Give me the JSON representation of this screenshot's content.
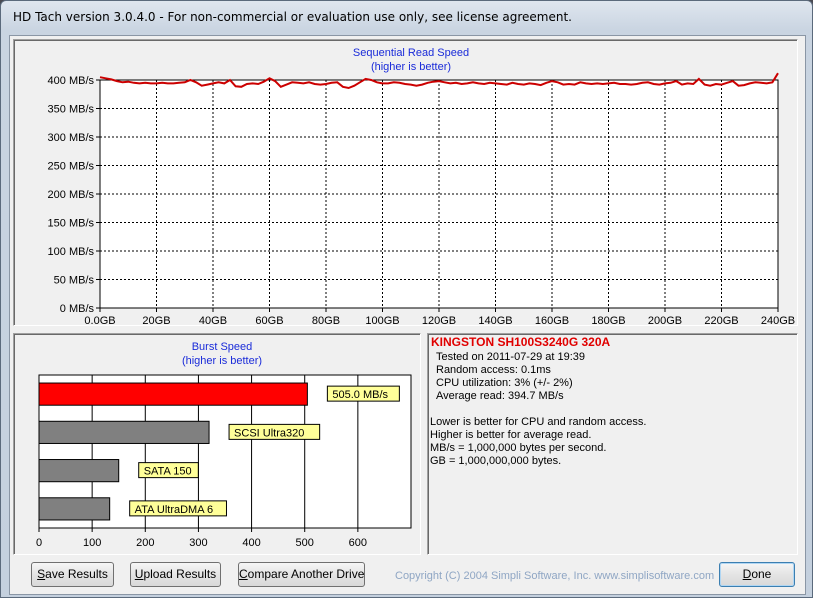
{
  "window": {
    "title": "HD Tach version 3.0.4.0  - For non-commercial or evaluation use only, see license agreement."
  },
  "sequential_chart": {
    "title_line1": "Sequential Read Speed",
    "title_line2": "(higher is better)"
  },
  "burst_chart": {
    "title_line1": "Burst Speed",
    "title_line2": "(higher is better)"
  },
  "chart_data": [
    {
      "type": "line",
      "title": "Sequential Read Speed",
      "subtitle": "(higher is better)",
      "xlabel": "",
      "ylabel": "",
      "x_tick_labels": [
        "0.0GB",
        "20GB",
        "40GB",
        "60GB",
        "80GB",
        "100GB",
        "120GB",
        "140GB",
        "160GB",
        "180GB",
        "200GB",
        "220GB",
        "240GB"
      ],
      "y_tick_labels": [
        "0 MB/s",
        "50 MB/s",
        "100 MB/s",
        "150 MB/s",
        "200 MB/s",
        "250 MB/s",
        "300 MB/s",
        "350 MB/s",
        "400 MB/s"
      ],
      "xlim": [
        0,
        240
      ],
      "ylim": [
        0,
        400
      ],
      "grid": true,
      "series_color": "#cc0000",
      "series": [
        {
          "x": [
            0,
            2,
            4,
            6,
            8,
            10,
            12,
            14,
            16,
            18,
            20,
            22,
            24,
            26,
            28,
            30,
            32,
            34,
            36,
            38,
            40,
            42,
            44,
            46,
            48,
            50,
            52,
            54,
            56,
            58,
            60,
            62,
            64,
            66,
            68,
            70,
            72,
            74,
            76,
            78,
            80,
            82,
            84,
            86,
            88,
            90,
            92,
            94,
            96,
            98,
            100,
            102,
            104,
            106,
            108,
            110,
            112,
            114,
            116,
            118,
            120,
            122,
            124,
            126,
            128,
            130,
            132,
            134,
            136,
            138,
            140,
            142,
            144,
            146,
            148,
            150,
            152,
            154,
            156,
            158,
            160,
            162,
            164,
            166,
            168,
            170,
            172,
            174,
            176,
            178,
            180,
            182,
            184,
            186,
            188,
            190,
            192,
            194,
            196,
            198,
            200,
            202,
            204,
            206,
            208,
            210,
            212,
            214,
            216,
            218,
            220,
            222,
            224,
            226,
            228,
            230,
            232,
            234,
            236,
            238,
            240
          ],
          "values": [
            405,
            403,
            401,
            398,
            396,
            397,
            395,
            394,
            395,
            394,
            394,
            395,
            394,
            394,
            395,
            396,
            400,
            396,
            390,
            392,
            394,
            396,
            394,
            400,
            389,
            388,
            393,
            394,
            393,
            397,
            403,
            398,
            388,
            392,
            396,
            395,
            394,
            396,
            393,
            392,
            393,
            395,
            396,
            388,
            386,
            390,
            396,
            402,
            400,
            396,
            394,
            394,
            396,
            395,
            393,
            392,
            390,
            392,
            395,
            397,
            398,
            396,
            394,
            395,
            393,
            394,
            396,
            394,
            393,
            395,
            394,
            393,
            392,
            395,
            393,
            392,
            394,
            393,
            391,
            395,
            398,
            396,
            392,
            393,
            392,
            396,
            394,
            393,
            394,
            393,
            394,
            395,
            393,
            393,
            392,
            393,
            395,
            396,
            393,
            392,
            394,
            395,
            398,
            392,
            394,
            393,
            402,
            392,
            390,
            393,
            392,
            395,
            398,
            390,
            391,
            394,
            396,
            395,
            394,
            396,
            412
          ]
        }
      ]
    },
    {
      "type": "bar",
      "title": "Burst Speed",
      "subtitle": "(higher is better)",
      "orientation": "horizontal",
      "categories": [
        "505.0 MB/s",
        "SCSI Ultra320",
        "SATA 150",
        "ATA UltraDMA 6"
      ],
      "values": [
        505.0,
        320,
        150,
        133
      ],
      "colors": [
        "#ff0000",
        "#808080",
        "#808080",
        "#808080"
      ],
      "x_tick_labels": [
        "0",
        "100",
        "200",
        "300",
        "400",
        "500",
        "600"
      ],
      "xlim": [
        0,
        700
      ],
      "label_background": "#ffff99"
    }
  ],
  "info": {
    "drive_name": "KINGSTON SH100S3240G 320A",
    "tested_on": "Tested on 2011-07-29 at 19:39",
    "random_access": "Random access: 0.1ms",
    "cpu_utilization": "CPU utilization: 3% (+/- 2%)",
    "average_read": "Average read: 394.7 MB/s",
    "note1": "Lower is better for CPU and random access.",
    "note2": "Higher is better for average read.",
    "note3": "MB/s = 1,000,000 bytes per second.",
    "note4": "GB = 1,000,000,000 bytes."
  },
  "buttons": {
    "save_results_first": "S",
    "save_results_rest": "ave Results",
    "upload_results_first": "U",
    "upload_results_rest": "pload Results",
    "compare_first": "C",
    "compare_rest": "ompare Another Drive",
    "done_first": "D",
    "done_rest": "one"
  },
  "footer": {
    "copyright": "Copyright (C) 2004 Simpli Software, Inc. www.simplisoftware.com"
  }
}
